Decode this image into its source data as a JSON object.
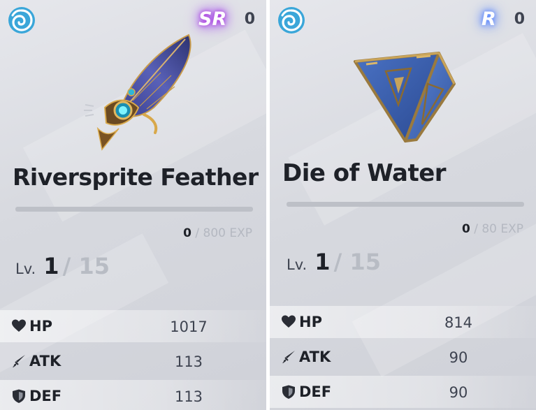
{
  "cards": [
    {
      "rarity": "SR",
      "count": "0",
      "name": "Riversprite Feather",
      "exp_current": "0",
      "exp_max": "/ 800 EXP",
      "level_prefix": "Lv.",
      "level_current": "1",
      "level_max": "/ 15",
      "stats": [
        {
          "icon": "heart-icon",
          "label": "HP",
          "value": "1017"
        },
        {
          "icon": "sword-icon",
          "label": "ATK",
          "value": "113"
        },
        {
          "icon": "shield-icon",
          "label": "DEF",
          "value": "113"
        }
      ]
    },
    {
      "rarity": "R",
      "count": "0",
      "name": "Die of Water",
      "exp_current": "0",
      "exp_max": "/ 80 EXP",
      "level_prefix": "Lv.",
      "level_current": "1",
      "level_max": "/ 15",
      "stats": [
        {
          "icon": "heart-icon",
          "label": "HP",
          "value": "814"
        },
        {
          "icon": "sword-icon",
          "label": "ATK",
          "value": "90"
        },
        {
          "icon": "shield-icon",
          "label": "DEF",
          "value": "90"
        }
      ]
    }
  ],
  "colors": {
    "sr_glow": "#b13ce0",
    "r_glow": "#5f8dff",
    "hydro": "#3aa6d9"
  }
}
